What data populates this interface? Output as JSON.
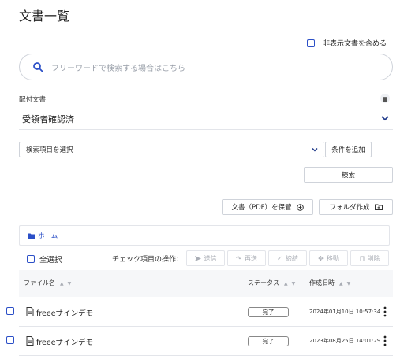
{
  "page": {
    "title": "文書一覧"
  },
  "filters": {
    "show_hidden_label": "非表示文書を含める",
    "search_placeholder": "フリーワードで検索する場合はこちら",
    "section_label": "配付文書",
    "selected_status": "受領者確認済",
    "search_field_select": "検索項目を選択",
    "add_condition": "条件を追加",
    "search_button": "検索"
  },
  "actions": {
    "save_pdf": "文書（PDF）を保管",
    "create_folder": "フォルダ作成"
  },
  "breadcrumb": {
    "home": "ホーム"
  },
  "toolbar": {
    "select_all": "全選択",
    "ops_label": "チェック項目の操作：",
    "send": "送信",
    "resend": "再送",
    "conclude": "締結",
    "move": "移動",
    "delete": "削除"
  },
  "table": {
    "col_filename": "ファイル名",
    "col_status": "ステータス",
    "col_created": "作成日時",
    "rows": [
      {
        "name": "freeeサインデモ",
        "status": "完了",
        "created": "2024年01月10日 10:57:34"
      },
      {
        "name": "freeeサインデモ",
        "status": "完了",
        "created": "2023年08月25日 14:01:29"
      }
    ]
  },
  "colors": {
    "accent": "#2b4fc7",
    "border": "#cfd3da",
    "disabled": "#a9adb5"
  }
}
